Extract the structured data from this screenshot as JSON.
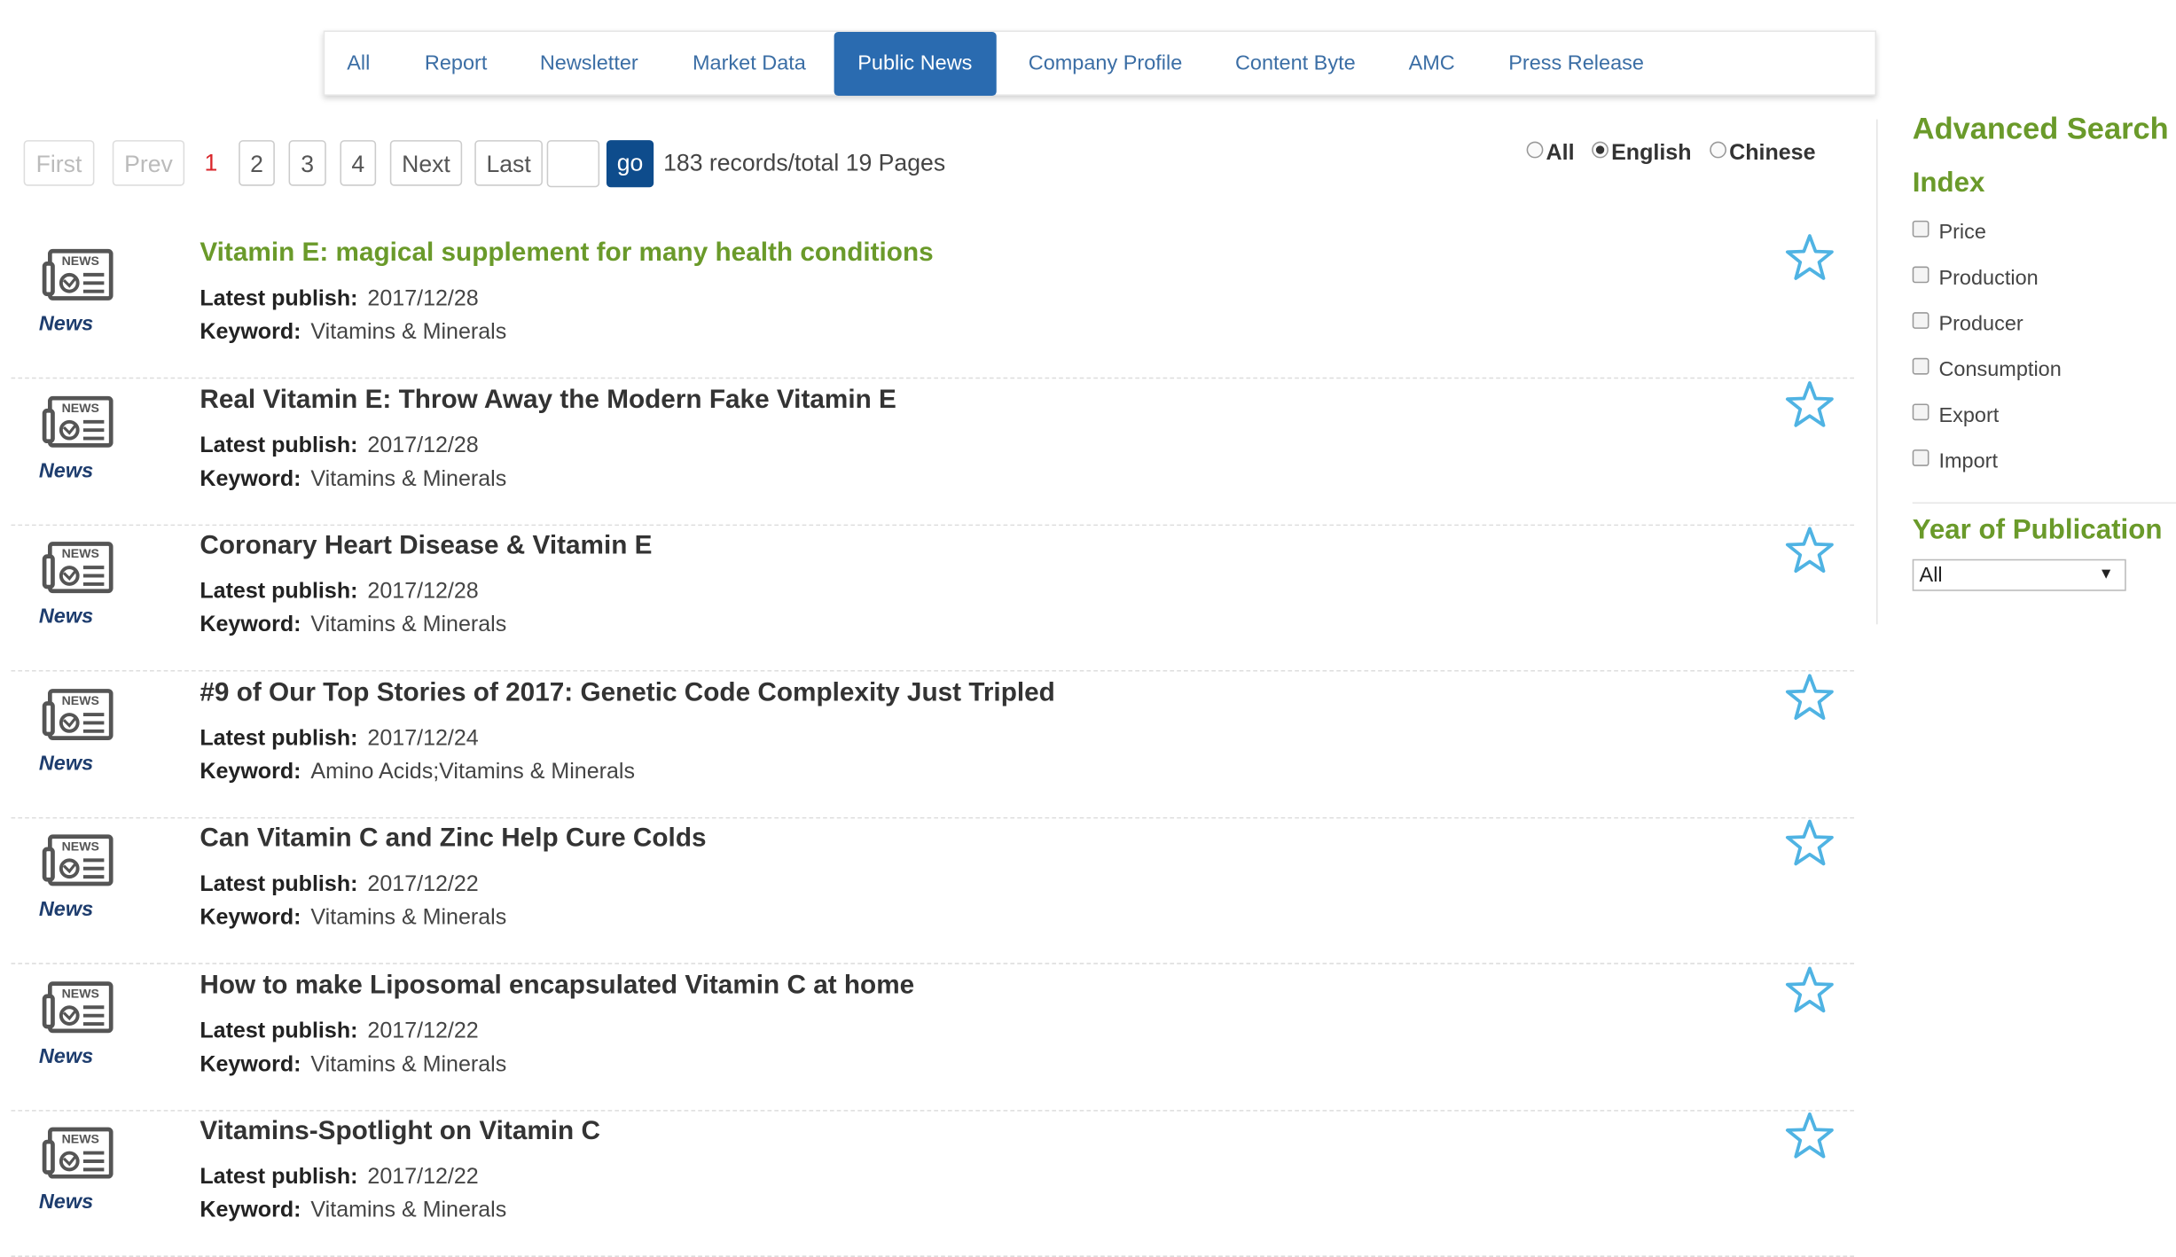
{
  "tabs": [
    "All",
    "Report",
    "Newsletter",
    "Market Data",
    "Public News",
    "Company Profile",
    "Content Byte",
    "AMC",
    "Press Release"
  ],
  "active_tab": "Public News",
  "pagination": {
    "first": "First",
    "prev": "Prev",
    "pages": [
      "1",
      "2",
      "3",
      "4"
    ],
    "current": "1",
    "next": "Next",
    "last": "Last",
    "go": "go",
    "input_value": "",
    "records": "183 records/total 19 Pages"
  },
  "language": {
    "options": [
      "All",
      "English",
      "Chinese"
    ],
    "selected": "English"
  },
  "news_type_label": "News",
  "meta_labels": {
    "publish": "Latest publish:",
    "keyword": "Keyword:"
  },
  "items": [
    {
      "title": "Vitamin E: magical supplement for many health conditions",
      "date": "2017/12/28",
      "keyword": "Vitamins & Minerals",
      "highlight": true
    },
    {
      "title": "Real Vitamin E: Throw Away the Modern Fake Vitamin E",
      "date": "2017/12/28",
      "keyword": "Vitamins & Minerals"
    },
    {
      "title": "Coronary Heart Disease & Vitamin E",
      "date": "2017/12/28",
      "keyword": "Vitamins & Minerals"
    },
    {
      "title": "#9 of Our Top Stories of 2017: Genetic Code Complexity Just Tripled",
      "date": "2017/12/24",
      "keyword": "Amino Acids;Vitamins & Minerals"
    },
    {
      "title": "Can Vitamin C and Zinc Help Cure Colds",
      "date": "2017/12/22",
      "keyword": "Vitamins & Minerals"
    },
    {
      "title": "How to make Liposomal encapsulated Vitamin C at home",
      "date": "2017/12/22",
      "keyword": "Vitamins & Minerals"
    },
    {
      "title": "Vitamins-Spotlight on Vitamin C",
      "date": "2017/12/22",
      "keyword": "Vitamins & Minerals"
    }
  ],
  "sidebar": {
    "advanced_search": "Advanced Search",
    "index_title": "Index",
    "index_options": [
      "Price",
      "Production",
      "Producer",
      "Consumption",
      "Export",
      "Import"
    ],
    "year_title": "Year of Publication",
    "year_selected": "All"
  },
  "colors": {
    "accent_green": "#6a9a2a",
    "tab_active": "#2a6bb0",
    "go_button": "#0e4c8c",
    "star": "#4fb3e3",
    "current_page": "#d9262b"
  }
}
